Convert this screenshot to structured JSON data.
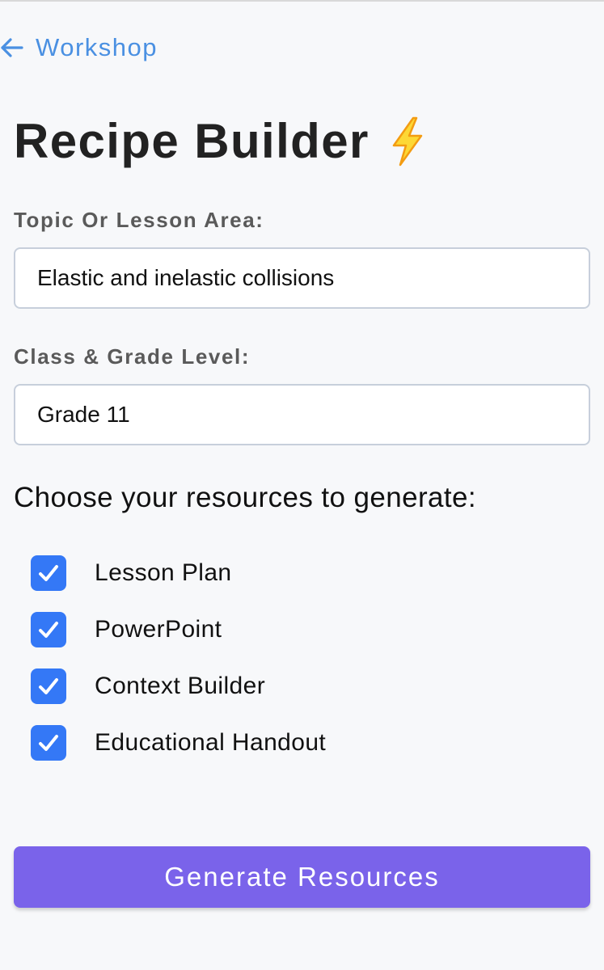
{
  "nav": {
    "back_label": "Workshop",
    "back_icon": "arrow-left-icon"
  },
  "header": {
    "title": "Recipe Builder",
    "title_icon": "lightning-bolt-icon"
  },
  "form": {
    "topic": {
      "label": "Topic Or Lesson Area:",
      "value": "Elastic and inelastic collisions"
    },
    "grade": {
      "label": "Class & Grade Level:",
      "value": "Grade 11"
    }
  },
  "resources": {
    "heading": "Choose your resources to generate:",
    "items": [
      {
        "label": "Lesson Plan",
        "checked": true
      },
      {
        "label": "PowerPoint",
        "checked": true
      },
      {
        "label": "Context Builder",
        "checked": true
      },
      {
        "label": "Educational Handout",
        "checked": true
      }
    ]
  },
  "actions": {
    "generate_label": "Generate Resources"
  },
  "colors": {
    "link": "#4a90e2",
    "checkbox": "#3478f6",
    "button": "#7a63ea",
    "background": "#f7f8fa"
  }
}
